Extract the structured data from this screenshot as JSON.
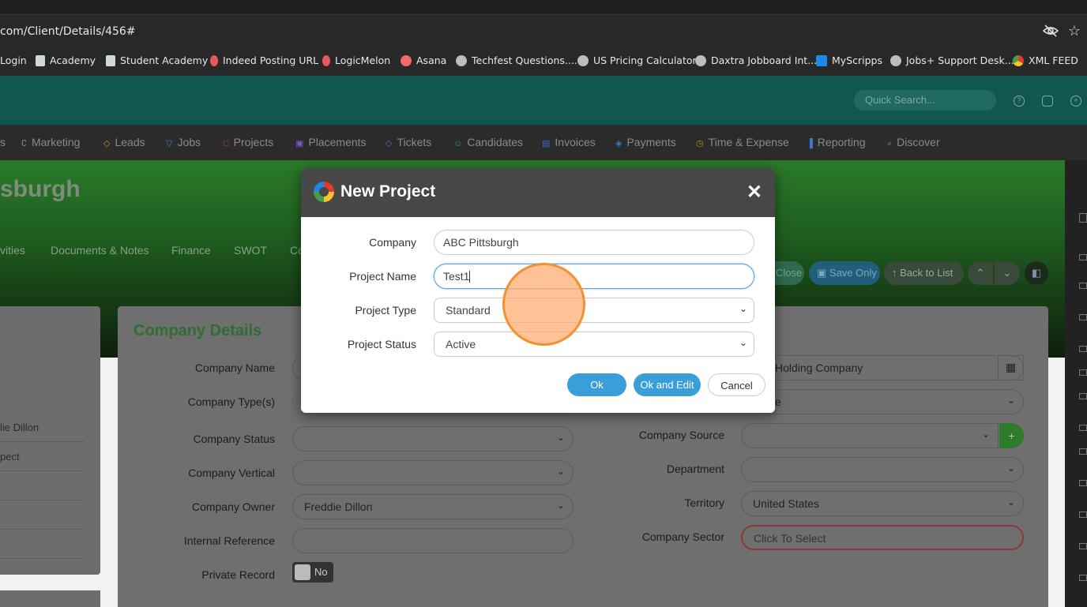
{
  "browser": {
    "url": "com/Client/Details/456#",
    "bookmarks": [
      {
        "label": "Login",
        "color": "#7c7c7c"
      },
      {
        "label": "Academy",
        "color": "#cfd8dc"
      },
      {
        "label": "Student Academy",
        "color": "#cfd8dc"
      },
      {
        "label": "Indeed Posting URL",
        "color": "#e35a5a"
      },
      {
        "label": "LogicMelon",
        "color": "#e35a5a"
      },
      {
        "label": "Asana",
        "color": "#f06a6a"
      },
      {
        "label": "Techfest Questions....",
        "color": "#bdbdbd"
      },
      {
        "label": "US Pricing Calculator",
        "color": "#bdbdbd"
      },
      {
        "label": "Daxtra Jobboard Int...",
        "color": "#bdbdbd"
      },
      {
        "label": "MyScripps",
        "color": "#1e88e5"
      },
      {
        "label": "Jobs+ Support Desk...",
        "color": "#bdbdbd"
      },
      {
        "label": "XML FEED",
        "color": "#fbc02d"
      }
    ]
  },
  "header": {
    "search_placeholder": "Quick Search..."
  },
  "nav": [
    {
      "label": "Marketing",
      "icon": "marketing-icon",
      "glyph": "∁"
    },
    {
      "label": "Leads",
      "icon": "leads-icon",
      "glyph": "◇"
    },
    {
      "label": "Jobs",
      "icon": "jobs-icon",
      "glyph": "▽"
    },
    {
      "label": "Projects",
      "icon": "projects-icon",
      "glyph": "□"
    },
    {
      "label": "Placements",
      "icon": "placements-icon",
      "glyph": "▣"
    },
    {
      "label": "Tickets",
      "icon": "tickets-icon",
      "glyph": "◇"
    },
    {
      "label": "Candidates",
      "icon": "candidates-icon",
      "glyph": "☺"
    },
    {
      "label": "Invoices",
      "icon": "invoices-icon",
      "glyph": "▤"
    },
    {
      "label": "Payments",
      "icon": "payments-icon",
      "glyph": "◈"
    },
    {
      "label": "Time & Expense",
      "icon": "time-icon",
      "glyph": "◷"
    },
    {
      "label": "Reporting",
      "icon": "reporting-icon",
      "glyph": "▐"
    },
    {
      "label": "Discover",
      "icon": "discover-icon",
      "glyph": "⌕"
    }
  ],
  "hero": {
    "title": "sburgh",
    "tabs": [
      "vities",
      "Documents & Notes",
      "Finance",
      "SWOT",
      "Co"
    ],
    "buttons": {
      "close": "Close",
      "save_only": "Save Only",
      "back_to_list": "Back to List"
    }
  },
  "left_panel": {
    "items": [
      "lie Dillon",
      "pect"
    ]
  },
  "company_details": {
    "title": "Company Details",
    "left_labels": [
      "Company Name",
      "Company Type(s)",
      "Company Status",
      "Company Vertical",
      "Company Owner",
      "Internal Reference",
      "Private Record"
    ],
    "company_owner_value": "Freddie Dillon",
    "private_record_value": "No",
    "right_labels": [
      "Company Source",
      "Department",
      "Territory",
      "Company Sector"
    ],
    "holding_value": "Holding Company",
    "second_value": "e",
    "territory_value": "United States",
    "sector_placeholder": "Click To Select"
  },
  "modal": {
    "title": "New Project",
    "fields": [
      {
        "label": "Company",
        "value": "ABC Pittsburgh"
      },
      {
        "label": "Project Name",
        "value": "Test1"
      },
      {
        "label": "Project Type",
        "value": "Standard"
      },
      {
        "label": "Project Status",
        "value": "Active"
      }
    ],
    "buttons": {
      "ok": "Ok",
      "ok_and_edit": "Ok and Edit",
      "cancel": "Cancel"
    }
  },
  "colors": {
    "accent": "#3a9fd8",
    "header_teal": "#12574f",
    "green_title": "#2f6d31",
    "click_marker": "#f39130"
  }
}
